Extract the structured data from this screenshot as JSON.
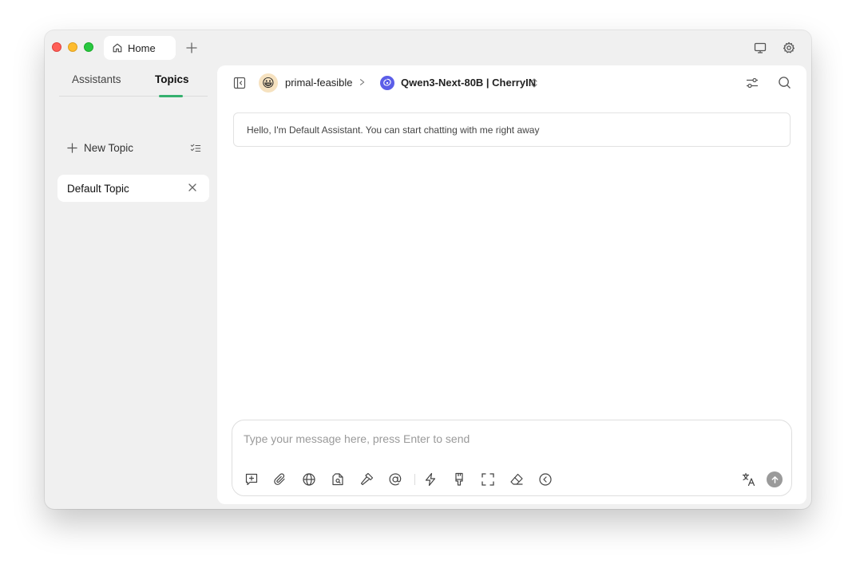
{
  "titlebar": {
    "home_tab_label": "Home",
    "home_icon": "home-icon",
    "new_tab_icon": "plus-icon",
    "right_icons": [
      "monitor-icon",
      "gear-icon"
    ]
  },
  "sidebar": {
    "tabs": [
      {
        "label": "Assistants",
        "active": false
      },
      {
        "label": "Topics",
        "active": true
      }
    ],
    "new_topic_label": "New Topic",
    "topics": [
      {
        "label": "Default Topic"
      }
    ]
  },
  "header": {
    "assistant_name": "primal-feasible",
    "assistant_avatar": "😀",
    "model_name": "Qwen3-Next-80B | CherryIN"
  },
  "chat": {
    "greeting": "Hello, I'm Default Assistant. You can start chatting with me right away"
  },
  "composer": {
    "placeholder": "Type your message here, press Enter to send",
    "value": "",
    "tools": [
      "new-topic-icon",
      "attachment-icon",
      "globe-icon",
      "file-search-icon",
      "hammer-icon",
      "at-icon",
      "lightning-icon",
      "brush-icon",
      "expand-icon",
      "eraser-icon",
      "chevron-left-circle-icon"
    ]
  },
  "colors": {
    "accent": "#35b06e",
    "window_bg": "#f0f0f0",
    "panel_bg": "#ffffff",
    "model_logo": "#5b5ee8"
  }
}
